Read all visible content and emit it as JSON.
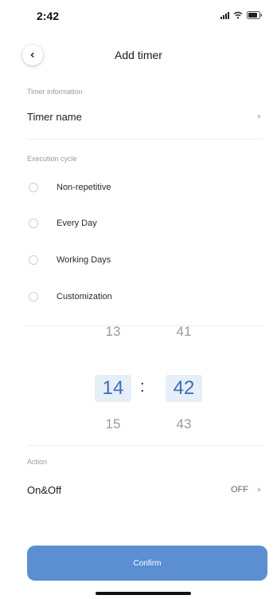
{
  "status_bar": {
    "time": "2:42",
    "icons": [
      "signal-icon",
      "wifi-icon",
      "battery-icon"
    ]
  },
  "header": {
    "title": "Add timer",
    "back_icon": "chevron-left-icon"
  },
  "timer_info": {
    "section_label": "Timer information",
    "name_label": "Timer name"
  },
  "execution_cycle": {
    "section_label": "Execution cycle",
    "options": [
      {
        "label": "Non-repetitive"
      },
      {
        "label": "Every Day"
      },
      {
        "label": "Working Days"
      },
      {
        "label": "Customization"
      }
    ]
  },
  "time_picker": {
    "hours": [
      "13",
      "14",
      "15"
    ],
    "minutes": [
      "41",
      "42",
      "43"
    ],
    "separator": ":",
    "selected_hour": "14",
    "selected_minute": "42"
  },
  "action": {
    "section_label": "Action",
    "name": "On&Off",
    "value": "OFF"
  },
  "footer": {
    "confirm_label": "Confirm"
  },
  "colors": {
    "accent": "#5b8fd1",
    "picker_selected_bg": "#e6eef8",
    "picker_selected_text": "#3a6fb8"
  }
}
